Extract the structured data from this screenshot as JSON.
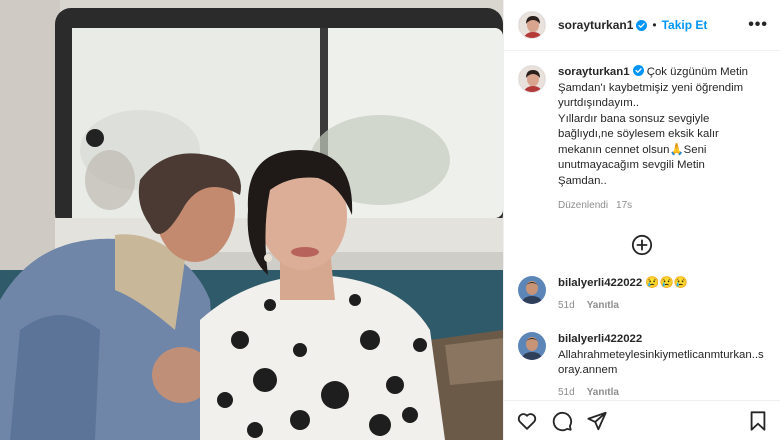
{
  "header": {
    "username": "sorayturkan1",
    "separator": "•",
    "follow_label": "Takip Et",
    "more_label": "•••"
  },
  "caption": {
    "username": "sorayturkan1",
    "text_lines": [
      "Çok üzgünüm Metin",
      "Şamdan'ı kaybetmişiz yeni öğrendim",
      "yurtdışındayım..",
      "Yıllardır bana sonsuz sevgiyle",
      "bağlıydı,ne söylesem eksik kalır",
      "mekanın cennet olsun🙏Seni",
      "unutmayacağım sevgili Metin",
      "Şamdan.."
    ],
    "edited_label": "Düzenlendi",
    "time": "17s"
  },
  "comments": [
    {
      "username": "bilalyerli422022",
      "text": "😢😢😢",
      "age": "51d",
      "reply_label": "Yanıtla"
    },
    {
      "username": "bilalyerli422022",
      "text_lines": [
        "Allahrahmeteylesinkiymetlicanmturkan..s",
        "oray.annem"
      ],
      "age": "51d",
      "reply_label": "Yanıtla"
    }
  ],
  "icons": {
    "verified": "verified-badge-icon",
    "more_comments": "plus-circle-icon",
    "like": "heart-icon",
    "comment": "comment-bubble-icon",
    "share": "paper-plane-icon",
    "save": "bookmark-icon"
  },
  "colors": {
    "accent": "#0095f6",
    "text": "#262626",
    "muted": "#8e8e8e",
    "divider": "#efefef"
  }
}
